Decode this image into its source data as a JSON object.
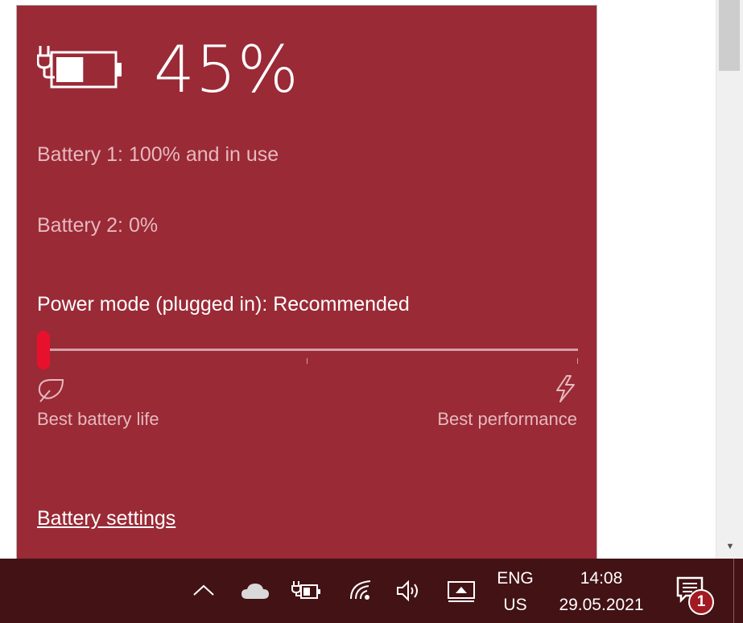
{
  "flyout": {
    "percent_text": "45%",
    "battery_level": 0.45,
    "battery1_text": "Battery 1: 100% and in use",
    "battery2_text": "Battery 2: 0%",
    "power_mode_text": "Power mode (plugged in): Recommended",
    "power_mode_position": 0,
    "slider_left_label": "Best battery life",
    "slider_right_label": "Best performance",
    "settings_link": "Battery settings",
    "icons": [
      "plug-battery-icon",
      "leaf-icon",
      "bolt-icon"
    ],
    "colors": {
      "background": "#9a2a36",
      "slider_thumb": "#e8112d",
      "secondary_text": "#e6b9be"
    }
  },
  "taskbar": {
    "language_top": "ENG",
    "language_bottom": "US",
    "time": "14:08",
    "date": "29.05.2021",
    "notification_count": "1",
    "tray_icons": [
      "chevron-up-icon",
      "cloud-icon",
      "battery-plug-icon",
      "wifi-icon",
      "volume-icon",
      "project-icon",
      "action-center-icon"
    ],
    "background": "#431215",
    "badge_color": "#a11a22"
  }
}
